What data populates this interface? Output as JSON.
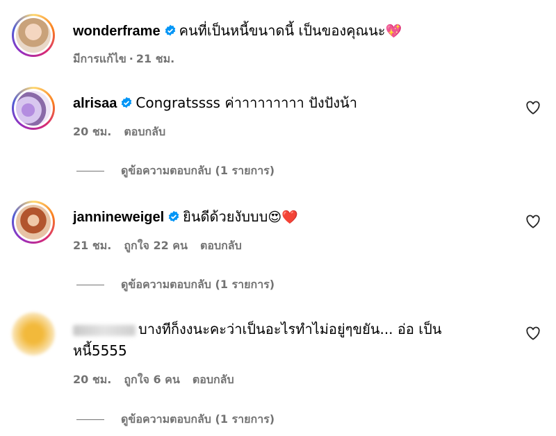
{
  "comments": [
    {
      "username": "wonderframe",
      "text": "คนที่เป็นหนี้ขนาดนี้ เป็นของคุณนะ",
      "emoji": "💖",
      "edited_label": "มีการแก้ไข",
      "separator": "·",
      "time": "21 ชม."
    },
    {
      "username": "alrisaa",
      "text": "Congratssss ค่าาาาาาาาา ปังปังน้า",
      "time": "20 ชม.",
      "reply_label": "ตอบกลับ",
      "view_replies": "ดูข้อความตอบกลับ (1 รายการ)"
    },
    {
      "username": "jannineweigel",
      "text": "ยินดีด้วยงับบบ",
      "emoji": "😍",
      "emoji2": "❤️",
      "time": "21 ชม.",
      "likes": "ถูกใจ 22 คน",
      "reply_label": "ตอบกลับ",
      "view_replies": "ดูข้อความตอบกลับ (1 รายการ)"
    },
    {
      "text_line1": "บางทีก็งงนะคะว่าเป็นอะไรทำไม่อยู่ๆขยัน... อ่อ เป็น",
      "text_line2": "หนี้5555",
      "time": "20 ชม.",
      "likes": "ถูกใจ 6 คน",
      "reply_label": "ตอบกลับ",
      "view_replies": "ดูข้อความตอบกลับ (1 รายการ)"
    }
  ],
  "icons": {
    "verified": "verified-badge-icon",
    "like": "heart-outline-icon"
  },
  "colors": {
    "verified": "#0095f6",
    "meta": "#737373"
  }
}
